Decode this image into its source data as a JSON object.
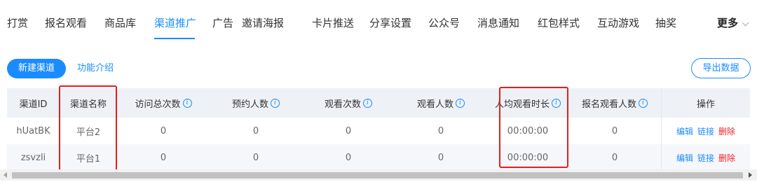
{
  "tabs": [
    {
      "label": "打赏"
    },
    {
      "label": "报名观看"
    },
    {
      "label": "商品库"
    },
    {
      "label": "渠道推广",
      "active": true
    },
    {
      "label": "广告"
    },
    {
      "label": "邀请海报"
    },
    {
      "label": "卡片推送"
    },
    {
      "label": "分享设置"
    },
    {
      "label": "公众号"
    },
    {
      "label": "消息通知"
    },
    {
      "label": "红包样式"
    },
    {
      "label": "互动游戏"
    },
    {
      "label": "抽奖"
    }
  ],
  "more_label": "更多",
  "actions": {
    "new_channel": "新建渠道",
    "intro": "功能介绍",
    "export": "导出数据"
  },
  "table": {
    "columns": [
      "渠道ID",
      "渠道名称",
      "访问总次数",
      "预约人数",
      "观看次数",
      "观看人数",
      "人均观看时长",
      "报名观看人数",
      "操作"
    ],
    "info_glyph": "i",
    "rows": [
      {
        "id": "hUatBK",
        "name": "平台2",
        "visits": "0",
        "reservations": "0",
        "views": "0",
        "viewers": "0",
        "avg_duration": "00:00:00",
        "signup_viewers": "0"
      },
      {
        "id": "zsvzli",
        "name": "平台1",
        "visits": "0",
        "reservations": "0",
        "views": "0",
        "viewers": "0",
        "avg_duration": "00:00:00",
        "signup_viewers": "0"
      }
    ],
    "ops": {
      "edit": "编辑",
      "link": "链接",
      "delete": "删除"
    }
  },
  "colors": {
    "accent": "#1a8cff",
    "danger": "#f5222d",
    "highlight": "#e02020"
  }
}
